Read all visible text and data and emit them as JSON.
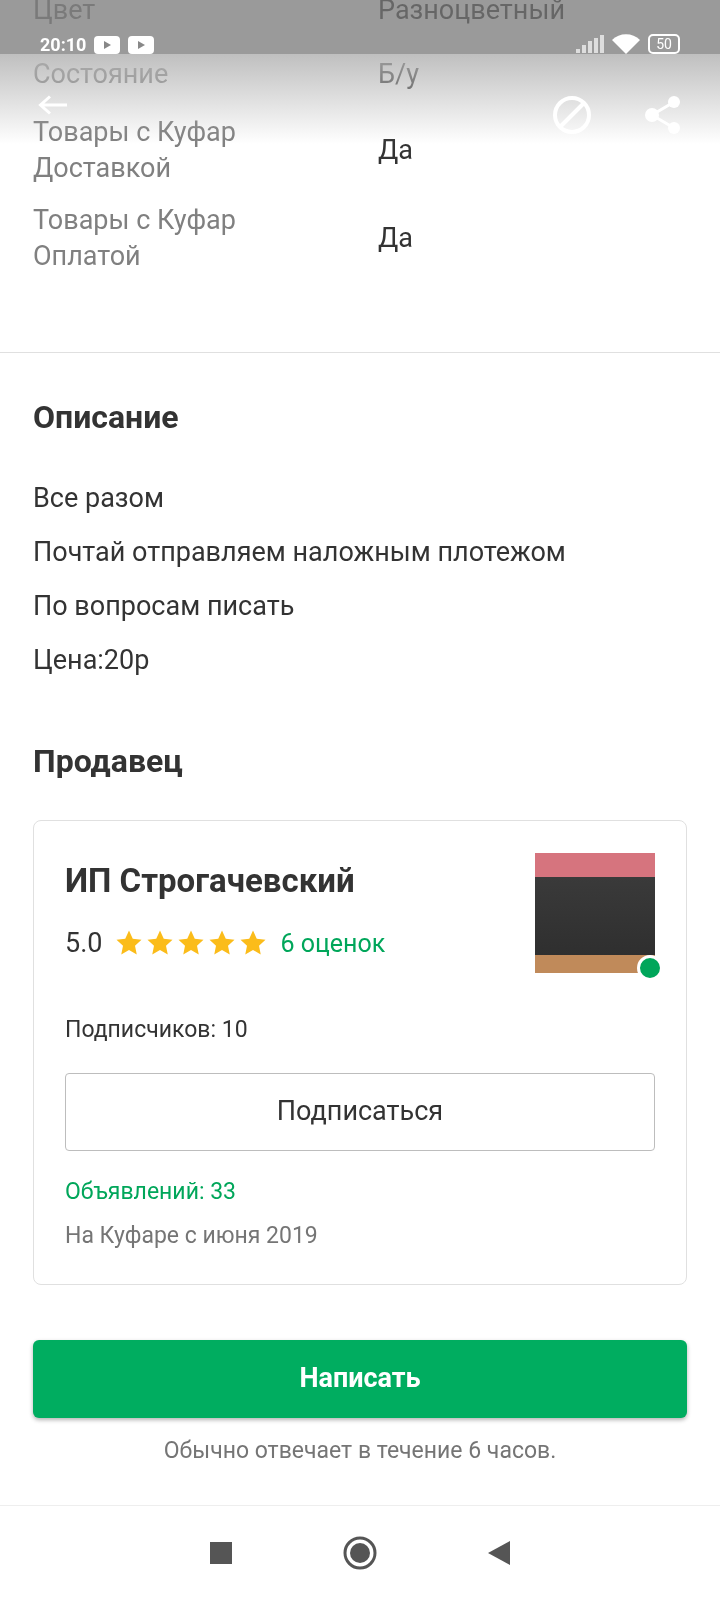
{
  "status_bar": {
    "time": "20:10",
    "battery": "50"
  },
  "specs": [
    {
      "label": "Цвет",
      "value": "Разноцветный"
    },
    {
      "label": "Состояние",
      "value": "Б/у"
    },
    {
      "label": "Товары с Куфар Доставкой",
      "value": "Да"
    },
    {
      "label": "Товары с Куфар Оплатой",
      "value": "Да"
    }
  ],
  "description": {
    "title": "Описание",
    "lines": [
      "Все разом",
      "Почтай отправляем наложным плотежом",
      "По вопросам писать",
      "Цена:20р"
    ]
  },
  "seller": {
    "title": "Продавец",
    "name": "ИП Строгачевский",
    "rating": "5.0",
    "stars": 5,
    "reviews": "6 оценок",
    "online": true,
    "subscribers": "Подписчиков: 10",
    "subscribe_button": "Подписаться",
    "ads": "Объявлений: 33",
    "since": "На Куфаре с июня 2019"
  },
  "write_button": "Написать",
  "reply_note": "Обычно отвечает в течение 6 часов."
}
